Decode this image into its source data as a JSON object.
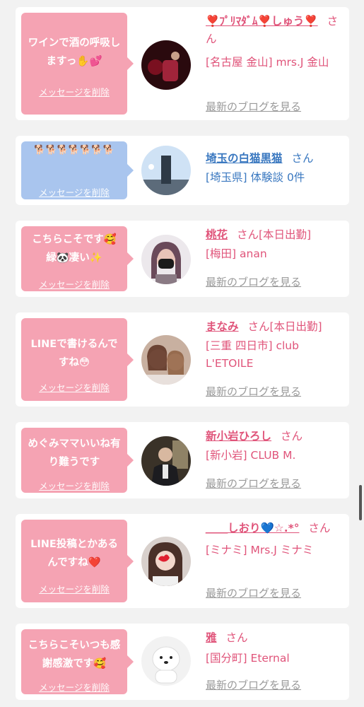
{
  "delete_label": "メッセージを削除",
  "blog_label": "最新のブログを見る",
  "san_label": "さん",
  "colors": {
    "pink_bubble": "#f5a3b3",
    "blue_bubble": "#a9c5ee",
    "pink_text": "#e0547a",
    "blue_text": "#3a78c0"
  },
  "cards": [
    {
      "message": "ワインで酒の呼吸しますっ✋💕",
      "name": "❣️ﾌﾟﾘﾏﾀﾞﾑ❣️しゅう❣️",
      "status": "",
      "shop": "[名古屋 金山] mrs.J 金山",
      "blog": true
    },
    {
      "message": "🐕🐕🐕🐕🐕🐕🐕",
      "name": "埼玉の白猫黒猫",
      "status": "",
      "shop": "[埼玉県] 体験談 0件",
      "blog": false
    },
    {
      "message": "こちらこそです🥰緑🐼凄い✨",
      "name": "桃花",
      "status": "[本日出勤]",
      "shop": "[梅田] anan",
      "blog": true
    },
    {
      "message": "LINEで書けるんですね😳",
      "name": "まなみ",
      "status": "[本日出勤]",
      "shop": "[三重 四日市] club L'ETOILE",
      "blog": true
    },
    {
      "message": "めぐみママいいね有り難うです",
      "name": "新小岩ひろし",
      "status": "",
      "shop": "[新小岩] CLUB M.",
      "blog": true
    },
    {
      "message": "LINE投稿とかあるんですね❤️",
      "name": "＿＿しおり💙☆.*°",
      "status": "",
      "shop": "[ミナミ] Mrs.J ミナミ",
      "blog": true
    },
    {
      "message": "こちらこそいつも感謝感激です🥰",
      "name": "雅",
      "status": "",
      "shop": "[国分町] Eternal",
      "blog": true
    }
  ]
}
